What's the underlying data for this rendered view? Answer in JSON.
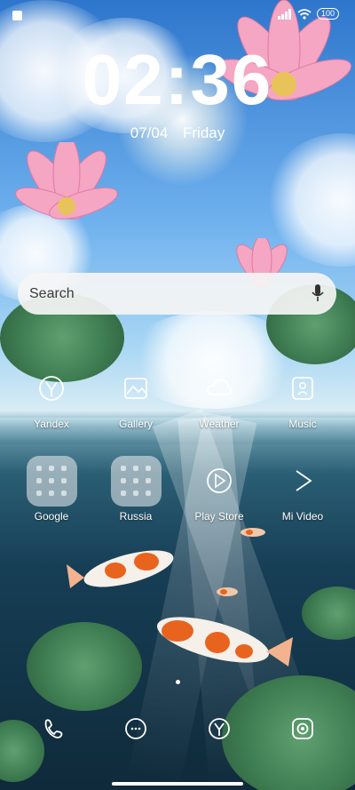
{
  "status_bar": {
    "battery": "100"
  },
  "lock": {
    "time": "02:36",
    "date": "07/04",
    "weekday": "Friday"
  },
  "search": {
    "placeholder": "Search"
  },
  "apps": [
    {
      "label": "Yandex",
      "icon": "yandex-icon"
    },
    {
      "label": "Gallery",
      "icon": "gallery-icon"
    },
    {
      "label": "Weather",
      "icon": "weather-icon"
    },
    {
      "label": "Music",
      "icon": "music-icon"
    },
    {
      "label": "Google",
      "icon": "folder-icon"
    },
    {
      "label": "Russia",
      "icon": "folder-icon"
    },
    {
      "label": "Play Store",
      "icon": "play-store-icon"
    },
    {
      "label": "Mi Video",
      "icon": "mi-video-icon"
    }
  ],
  "dock": [
    {
      "icon": "phone-icon"
    },
    {
      "icon": "messages-icon"
    },
    {
      "icon": "yandex-browser-icon"
    },
    {
      "icon": "camera-icon"
    }
  ],
  "page_indicator": {
    "current": 1,
    "total": 1
  }
}
